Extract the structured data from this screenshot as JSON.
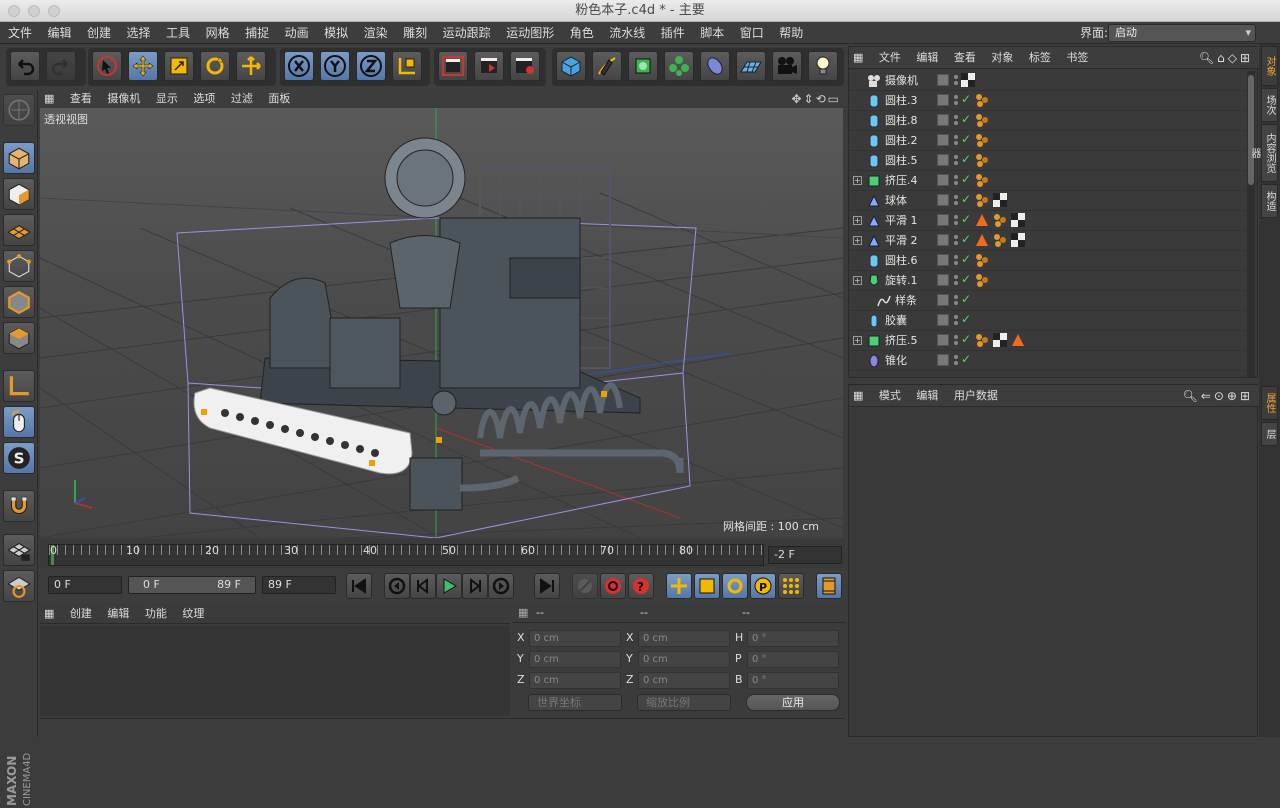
{
  "window": {
    "title": "粉色本子.c4d * - 主要"
  },
  "menubar": {
    "items": [
      "文件",
      "编辑",
      "创建",
      "选择",
      "工具",
      "网格",
      "捕捉",
      "动画",
      "模拟",
      "渲染",
      "雕刻",
      "运动跟踪",
      "运动图形",
      "角色",
      "流水线",
      "插件",
      "脚本",
      "窗口",
      "帮助"
    ],
    "layout_label": "界面:",
    "layout_value": "启动"
  },
  "viewport": {
    "menu": [
      "查看",
      "摄像机",
      "显示",
      "选项",
      "过滤",
      "面板"
    ],
    "view_name": "透视视图",
    "grid_spacing": "网格间距 : 100 cm"
  },
  "timeline": {
    "ticks": [
      "0",
      "10",
      "20",
      "30",
      "40",
      "50",
      "60",
      "70",
      "80"
    ],
    "end_label": "-2 F"
  },
  "controls": {
    "current_frame": "0 F",
    "range_start": "0 F",
    "range_end": "89 F",
    "max_frame": "89 F"
  },
  "material_panel": {
    "menu": [
      "创建",
      "编辑",
      "功能",
      "纹理"
    ]
  },
  "coord_panel": {
    "headers": [
      "--",
      "--",
      "--"
    ],
    "rows": [
      {
        "a": "X",
        "av": "0 cm",
        "b": "X",
        "bv": "0 cm",
        "c": "H",
        "cv": "0 °"
      },
      {
        "a": "Y",
        "av": "0 cm",
        "b": "Y",
        "bv": "0 cm",
        "c": "P",
        "cv": "0 °"
      },
      {
        "a": "Z",
        "av": "0 cm",
        "b": "Z",
        "bv": "0 cm",
        "c": "B",
        "cv": "0 °"
      }
    ],
    "coord_mode": "世界坐标",
    "scale_mode": "缩放比例",
    "apply": "应用"
  },
  "object_manager": {
    "menu": [
      "文件",
      "编辑",
      "查看",
      "对象",
      "标签",
      "书签"
    ],
    "objects": [
      {
        "name": "摄像机",
        "icon": "camera-icon"
      },
      {
        "name": "圆柱.3",
        "icon": "cylinder-icon"
      },
      {
        "name": "圆柱.8",
        "icon": "cylinder-icon"
      },
      {
        "name": "圆柱.2",
        "icon": "cylinder-icon"
      },
      {
        "name": "圆柱.5",
        "icon": "cylinder-icon"
      },
      {
        "name": "挤压.4",
        "icon": "extrude-icon"
      },
      {
        "name": "球体",
        "icon": "sphere-icon"
      },
      {
        "name": "平滑 1",
        "icon": "smooth-icon"
      },
      {
        "name": "平滑 2",
        "icon": "smooth-icon"
      },
      {
        "name": "圆柱.6",
        "icon": "cylinder-icon"
      },
      {
        "name": "旋转.1",
        "icon": "lathe-icon"
      },
      {
        "name": "样条",
        "icon": "spline-icon"
      },
      {
        "name": "胶囊",
        "icon": "capsule-icon"
      },
      {
        "name": "挤压.5",
        "icon": "extrude-icon"
      },
      {
        "name": "锥化",
        "icon": "taper-icon"
      }
    ]
  },
  "attribute_manager": {
    "menu": [
      "模式",
      "编辑",
      "用户数据"
    ]
  },
  "side_tabs": [
    "对象",
    "场次",
    "内容浏览器",
    "构造",
    "属性",
    "层"
  ],
  "brand": {
    "logo_text_1": "MAXON",
    "logo_text_2": "CINEMA4D"
  }
}
